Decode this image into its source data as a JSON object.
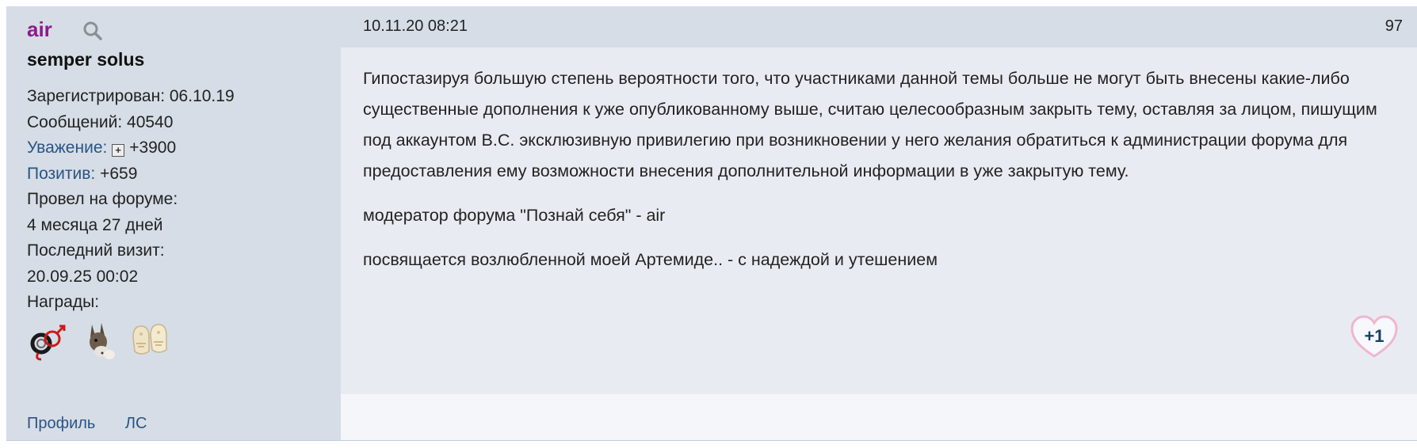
{
  "author": {
    "username": "air",
    "title": "semper solus",
    "registered_label": "Зарегистрирован:",
    "registered_value": "06.10.19",
    "posts_label": "Сообщений:",
    "posts_value": "40540",
    "respect_label": "Уважение:",
    "respect_value": "+3900",
    "positive_label": "Позитив:",
    "positive_value": "+659",
    "time_label": "Провел на форуме:",
    "time_value": "4 месяца 27 дней",
    "last_visit_label": "Последний визит:",
    "last_visit_value": "20.09.25 00:02",
    "awards_label": "Награды:",
    "awards": [
      "handcuffs-award-icon",
      "donkey-award-icon",
      "mittens-award-icon"
    ],
    "profile_link": "Профиль",
    "pm_link": "ЛС"
  },
  "post": {
    "date": "10.11.20 08:21",
    "number": "97",
    "paragraphs": [
      "Гипостазируя  большую степень вероятности того, что участниками данной темы больше не могут быть внесены какие-либо существенные дополнения к уже опубликованному выше, считаю целесообразным закрыть тему, оставляя за лицом, пишущим под аккаунтом В.С. эксклюзивную привилегию при возникновении у него желания  обратиться к администрации форума для предоставления ему возможности внесения дополнительной информации в уже закрытую тему.",
      "модератор форума \"Познай себя\"  - air",
      "посвящается возлюбленной моей Артемиде.. - с надеждой и утешением"
    ],
    "like_label": "+1"
  },
  "colors": {
    "username": "#8e1a8e",
    "link": "#2a5485",
    "panel_bg": "#d6dde6",
    "content_bg": "#e8ecf2"
  }
}
